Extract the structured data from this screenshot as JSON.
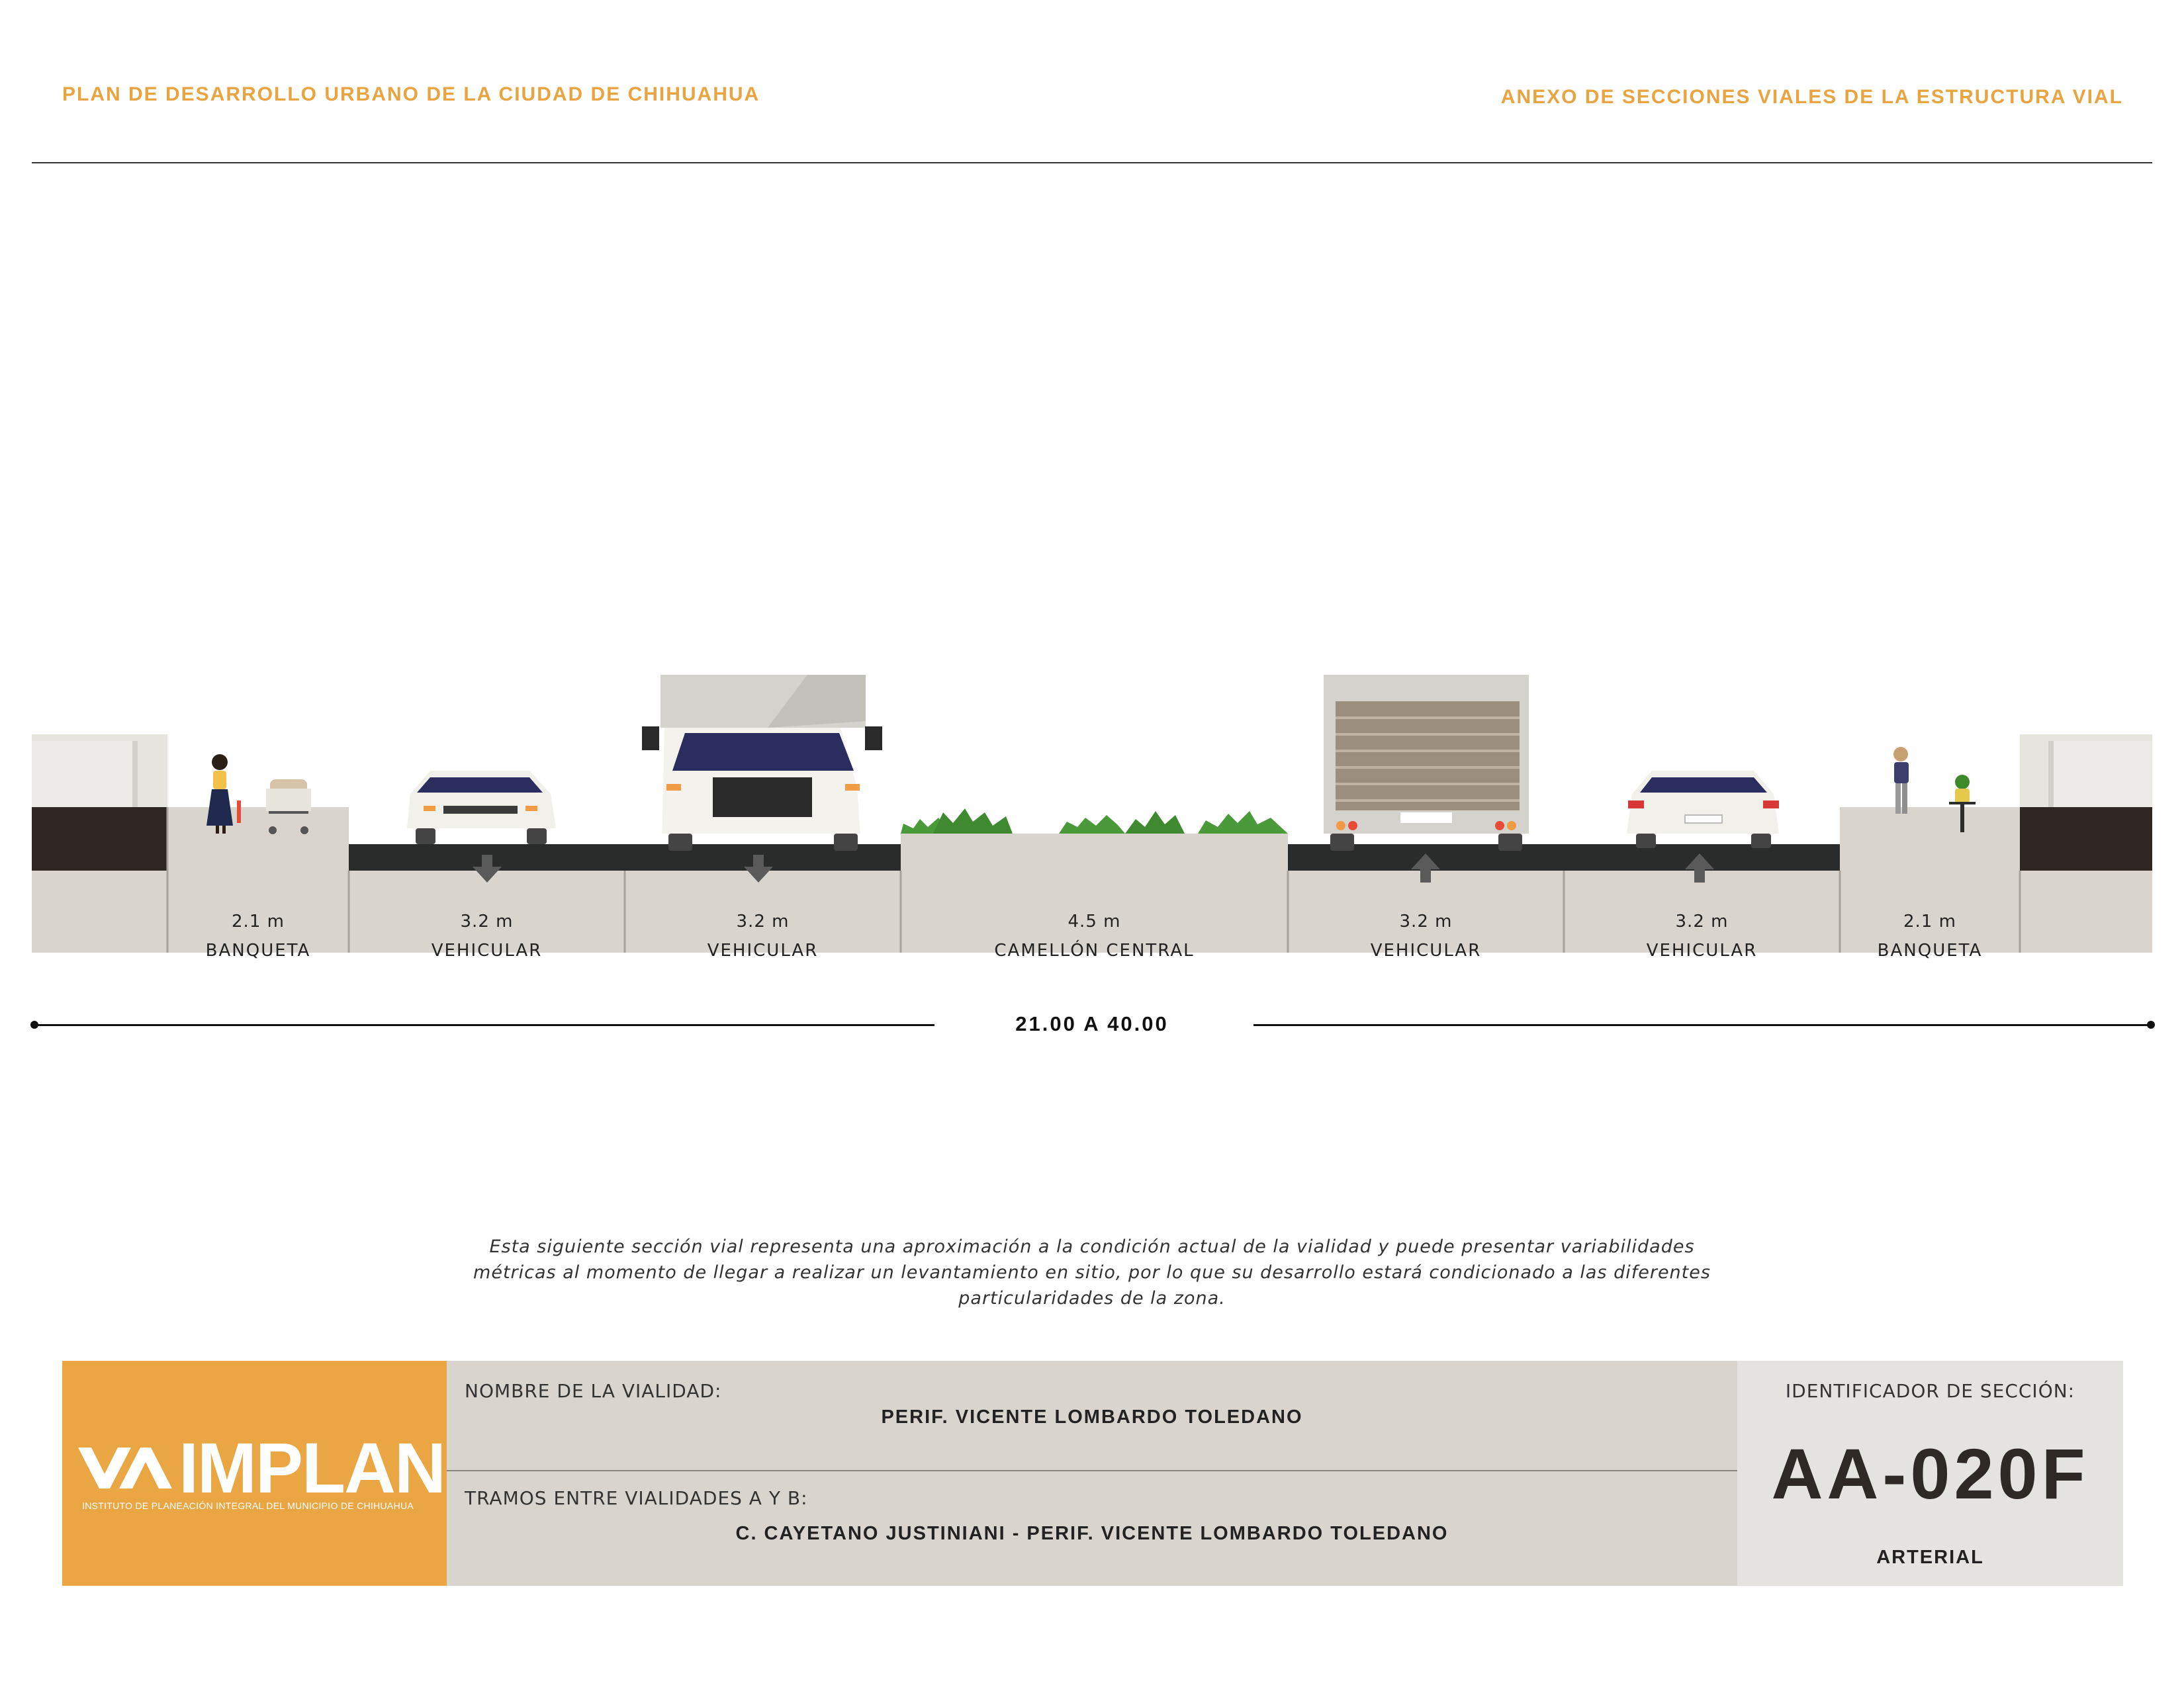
{
  "header": {
    "left_title": "PLAN DE DESARROLLO URBANO DE LA CIUDAD DE CHIHUAHUA",
    "right_title": "ANEXO DE SECCIONES VIALES DE LA ESTRUCTURA VIAL"
  },
  "segments": [
    {
      "width": "2.1 m",
      "label": "BANQUETA"
    },
    {
      "width": "3.2 m",
      "label": "VEHICULAR"
    },
    {
      "width": "3.2 m",
      "label": "VEHICULAR"
    },
    {
      "width": "4.5 m",
      "label": "CAMELLÓN CENTRAL"
    },
    {
      "width": "3.2 m",
      "label": "VEHICULAR"
    },
    {
      "width": "3.2 m",
      "label": "VEHICULAR"
    },
    {
      "width": "2.1 m",
      "label": "BANQUETA"
    }
  ],
  "total_width": "21.00 A 40.00",
  "note": "Esta siguiente sección vial representa una aproximación a la condición actual de la vialidad y puede presentar variabilidades métricas al momento de llegar a realizar un levantamiento en sitio, por lo que su desarrollo estará condicionado a las diferentes particularidades de la zona.",
  "title_block": {
    "logo_text": "IMPLAN",
    "logo_subtitle": "INSTITUTO DE PLANEACIÓN INTEGRAL DEL MUNICIPIO DE CHIHUAHUA",
    "road_name_label": "NOMBRE DE LA VIALIDAD:",
    "road_name": "PERIF. VICENTE LOMBARDO TOLEDANO",
    "segments_label": "TRAMOS ENTRE VIALIDADES A Y B:",
    "segments_value": "C. CAYETANO JUSTINIANI - PERIF. VICENTE LOMBARDO TOLEDANO",
    "id_label": "IDENTIFICADOR DE SECCIÓN:",
    "id_value": "AA-020F",
    "classification": "ARTERIAL"
  },
  "colors": {
    "accent": "#e8a440",
    "asphalt": "#2a2c2b",
    "sidewalk": "#d9d4cd",
    "median_green": "#4a9a3a",
    "windshield": "#2b2d5e"
  }
}
